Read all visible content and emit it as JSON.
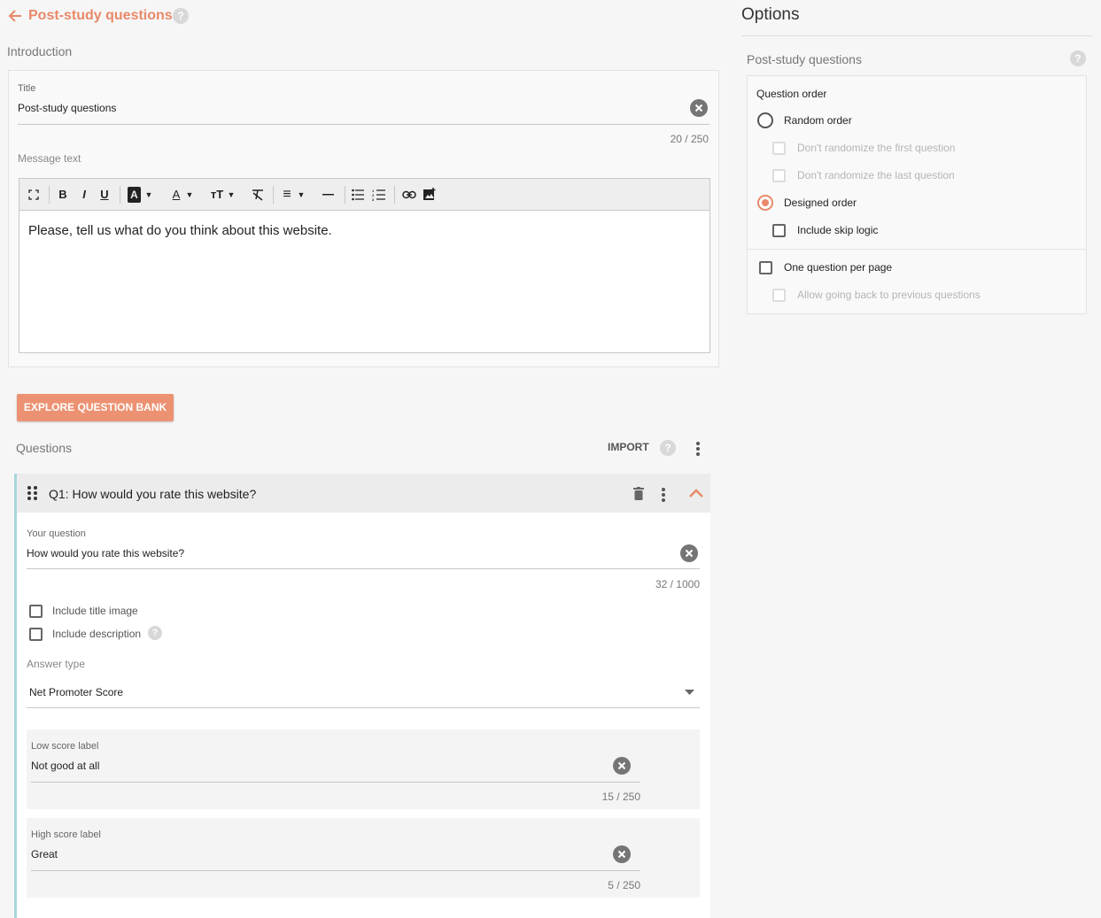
{
  "header": {
    "title": "Post-study questions",
    "help": "?"
  },
  "intro": {
    "section_label": "Introduction",
    "title_label": "Title",
    "title_value": "Post-study questions",
    "title_counter": "20 / 250",
    "message_label": "Message text",
    "message_body": "Please, tell us what do you think about this website."
  },
  "toolbar": {
    "bold": "B",
    "italic": "I",
    "underline": "U",
    "bg_color": "A",
    "text_color": "A",
    "font_size": "тT",
    "align": "≡"
  },
  "actions": {
    "explore": "EXPLORE QUESTION BANK",
    "import": "IMPORT"
  },
  "questions": {
    "section_label": "Questions",
    "q1": {
      "header": "Q1: How would you rate this website?",
      "your_question_label": "Your question",
      "your_question_value": "How would you rate this website?",
      "question_counter": "32 / 1000",
      "include_title_image": "Include title image",
      "include_description": "Include description",
      "answer_type_label": "Answer type",
      "answer_type_value": "Net Promoter Score",
      "low_label": "Low score label",
      "low_value": "Not good at all",
      "low_counter": "15 / 250",
      "high_label": "High score label",
      "high_value": "Great",
      "high_counter": "5 / 250"
    }
  },
  "options": {
    "title": "Options",
    "section_label": "Post-study questions",
    "question_order_label": "Question order",
    "random_order": "Random order",
    "dont_randomize_first": "Don't randomize the first question",
    "dont_randomize_last": "Don't randomize the last question",
    "designed_order": "Designed order",
    "include_skip_logic": "Include skip logic",
    "one_per_page": "One question per page",
    "allow_back": "Allow going back to previous questions",
    "selected_order": "Designed order"
  },
  "colors": {
    "accent": "#e8896a",
    "card_border_accent": "#a8d8db"
  }
}
